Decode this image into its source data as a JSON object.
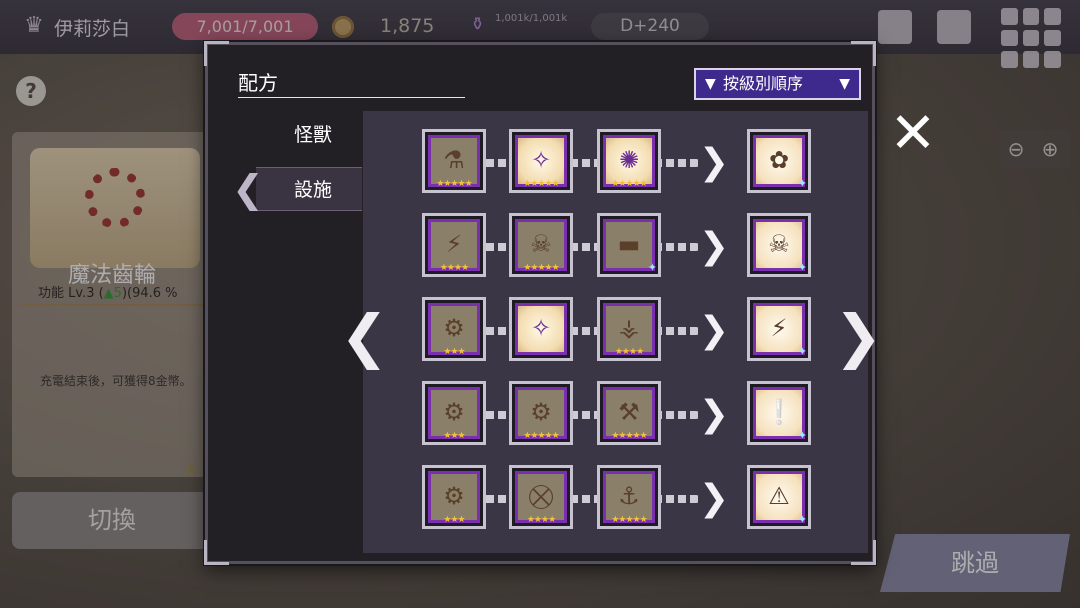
{
  "topbar": {
    "player_name": "伊莉莎白",
    "stamina": "7,001/7,001",
    "coins": "1,875",
    "potion": "1,001k/1,001k",
    "day": "D+240"
  },
  "left_panel": {
    "title": "魔法齒輪",
    "subtitle_prefix": "功能 Lv.3 (",
    "subtitle_up": "▲5",
    "subtitle_suffix": ")(94.6 %",
    "description": "充電結束後，可獲得8金幣。",
    "switch_label": "切換"
  },
  "skip_label": "跳過",
  "modal": {
    "title": "配方",
    "sort_label": "按級別順序",
    "tabs": [
      "怪獸",
      "設施"
    ],
    "active_tab": "設施"
  },
  "recipes": [
    {
      "items": [
        {
          "glyph": "⚗",
          "stars": "★★★★★",
          "glow": false
        },
        {
          "glyph": "✧",
          "stars": "★★★★★",
          "glow": true
        },
        {
          "glyph": "✺",
          "stars": "★★★★★",
          "glow": true
        }
      ],
      "result": {
        "glyph": "✿",
        "spark": "✦"
      }
    },
    {
      "items": [
        {
          "glyph": "⚡",
          "stars": "★★★★",
          "glow": false
        },
        {
          "glyph": "☠",
          "stars": "★★★★★",
          "glow": false
        },
        {
          "glyph": "▬",
          "stars": "",
          "glow": false,
          "spark": "✦"
        }
      ],
      "result": {
        "glyph": "☠",
        "spark": "✦"
      }
    },
    {
      "items": [
        {
          "glyph": "⚙",
          "stars": "★★★",
          "glow": false
        },
        {
          "glyph": "✧",
          "stars": "",
          "glow": true
        },
        {
          "glyph": "⚶",
          "stars": "★★★★",
          "glow": false
        }
      ],
      "result": {
        "glyph": "⚡",
        "spark": "✦"
      }
    },
    {
      "items": [
        {
          "glyph": "⚙",
          "stars": "★★★",
          "glow": false
        },
        {
          "glyph": "⚙",
          "stars": "★★★★★",
          "glow": false
        },
        {
          "glyph": "⚒",
          "stars": "★★★★★",
          "glow": false
        }
      ],
      "result": {
        "glyph": "❕",
        "spark": "✦"
      }
    },
    {
      "items": [
        {
          "glyph": "⚙",
          "stars": "★★★",
          "glow": false
        },
        {
          "glyph": "⛒",
          "stars": "★★★★",
          "glow": false
        },
        {
          "glyph": "⚓",
          "stars": "★★★★★",
          "glow": false
        }
      ],
      "result": {
        "glyph": "⚠",
        "spark": "✦"
      }
    }
  ],
  "icons": {
    "close": "✕",
    "arrow_left": "❮",
    "arrow_right": "❯",
    "recipe_arrow": "❯",
    "funnel": "▼",
    "caret": "▼",
    "zoom_out": "⊖",
    "zoom_in": "⊕"
  }
}
